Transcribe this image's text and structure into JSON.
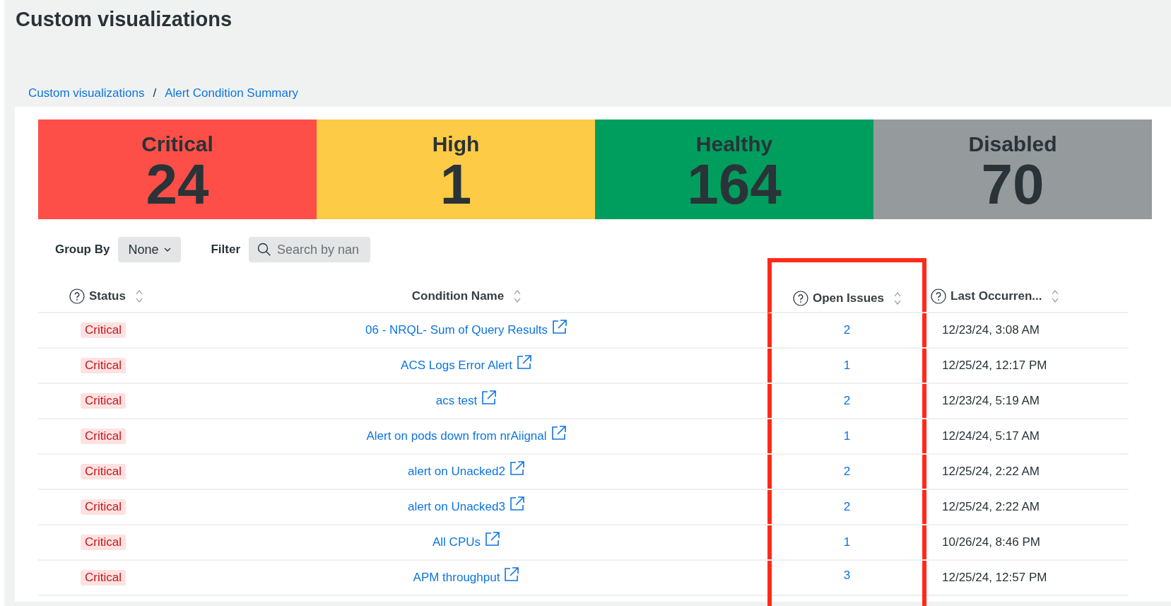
{
  "page_title": "Custom visualizations",
  "breadcrumbs": [
    "Custom visualizations",
    "Alert Condition Summary"
  ],
  "breadcrumb_separator": "/",
  "tiles": [
    {
      "label": "Critical",
      "count": "24",
      "color": "#fd4f47"
    },
    {
      "label": "High",
      "count": "1",
      "color": "#fdcb45"
    },
    {
      "label": "Healthy",
      "count": "164",
      "color": "#009e5e"
    },
    {
      "label": "Disabled",
      "count": "70",
      "color": "#959a9c"
    }
  ],
  "controls": {
    "group_by_label": "Group By",
    "group_by_value": "None",
    "filter_label": "Filter",
    "search_placeholder": "Search by nan"
  },
  "table": {
    "columns": [
      {
        "label": "Status",
        "help": true,
        "sortable": true,
        "highlighted": false
      },
      {
        "label": "Condition Name",
        "help": false,
        "sortable": true,
        "highlighted": false
      },
      {
        "label": "Open Issues",
        "help": true,
        "sortable": true,
        "highlighted": true
      },
      {
        "label": "Last Occurren...",
        "help": true,
        "sortable": true,
        "highlighted": false
      }
    ],
    "rows": [
      {
        "status": "Critical",
        "name": "06 - NRQL- Sum of Query Results",
        "open_issues": "2",
        "last_occurrence": "12/23/24, 3:08 AM"
      },
      {
        "status": "Critical",
        "name": "ACS Logs Error Alert",
        "open_issues": "1",
        "last_occurrence": "12/25/24, 12:17 PM"
      },
      {
        "status": "Critical",
        "name": "acs test",
        "open_issues": "2",
        "last_occurrence": "12/23/24, 5:19 AM"
      },
      {
        "status": "Critical",
        "name": "Alert on pods down from nrAiignal",
        "open_issues": "1",
        "last_occurrence": "12/24/24, 5:17 AM"
      },
      {
        "status": "Critical",
        "name": "alert on Unacked2",
        "open_issues": "2",
        "last_occurrence": "12/25/24, 2:22 AM"
      },
      {
        "status": "Critical",
        "name": "alert on Unacked3",
        "open_issues": "2",
        "last_occurrence": "12/25/24, 2:22 AM"
      },
      {
        "status": "Critical",
        "name": "All CPUs",
        "open_issues": "1",
        "last_occurrence": "10/26/24, 8:46 PM"
      },
      {
        "status": "Critical",
        "name": "APM throughput",
        "open_issues": "3",
        "last_occurrence": "12/25/24, 12:57 PM"
      }
    ]
  }
}
